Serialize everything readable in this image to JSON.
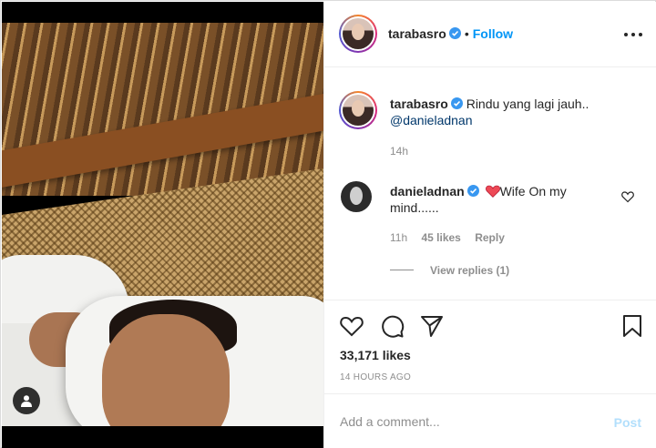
{
  "post": {
    "author": "tarabasro",
    "follow_label": "Follow",
    "dot": "•"
  },
  "caption": {
    "author": "tarabasro",
    "text": "Rindu yang lagi jauh..",
    "mention": "@danieladnan",
    "time": "14h"
  },
  "comment": {
    "author": "danieladnan",
    "text": "Wife On my mind......",
    "time": "11h",
    "likes": "45 likes",
    "reply_label": "Reply",
    "view_replies": "View replies (1)"
  },
  "stats": {
    "likes": "33,171 likes",
    "posted": "14 HOURS AGO"
  },
  "composer": {
    "placeholder": "Add a comment...",
    "post_label": "Post"
  },
  "colors": {
    "accent": "#0095f6",
    "verified": "#3897f0",
    "heart": "#ed4956",
    "post_disabled": "#b2dffc"
  },
  "icons": [
    "user-tag-icon",
    "verified-badge-icon",
    "more-options-icon",
    "heart-emoji-icon",
    "like-icon",
    "comment-icon",
    "share-icon",
    "save-icon",
    "comment-like-icon"
  ]
}
